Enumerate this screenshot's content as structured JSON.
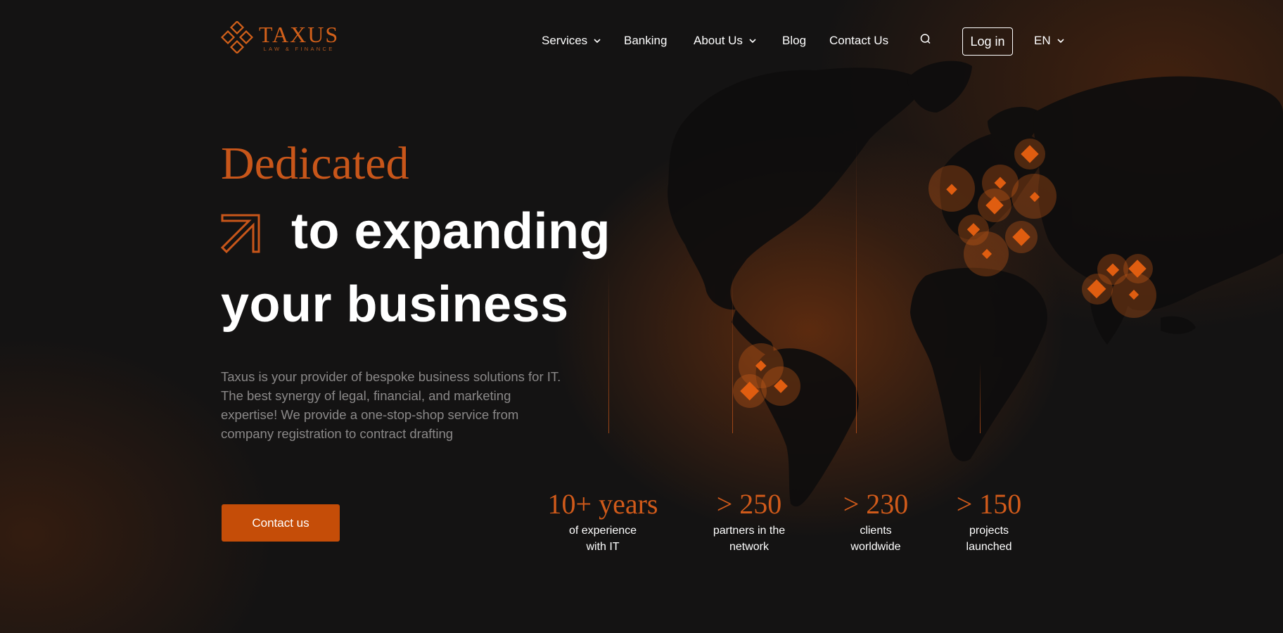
{
  "logo": {
    "name": "TAXUS",
    "tagline": "LAW & FINANCE",
    "icon": "diamond-cluster-logo",
    "brand_color": "#d2601a"
  },
  "nav": {
    "items": [
      {
        "label": "Services",
        "has_dropdown": true
      },
      {
        "label": "Banking",
        "has_dropdown": false
      },
      {
        "label": "About Us",
        "has_dropdown": true
      },
      {
        "label": "Blog",
        "has_dropdown": false
      },
      {
        "label": "Contact Us",
        "has_dropdown": false
      }
    ],
    "search_icon": "search-icon",
    "login_label": "Log in",
    "language": "EN"
  },
  "hero": {
    "line1": "Dedicated",
    "line2": "to expanding",
    "line3": "your business",
    "arrow_icon": "arrow-up-right-icon",
    "description": "Taxus is your provider of bespoke business solutions for IT. The best synergy of legal, financial, and marketing expertise! We provide a one-stop-shop service from company registration to contract drafting",
    "cta_label": "Contact us"
  },
  "stats": [
    {
      "value": "10+ years",
      "label_line1": "of experience",
      "label_line2": "with IT"
    },
    {
      "value": "> 250",
      "label_line1": "partners in the",
      "label_line2": "network"
    },
    {
      "value": "> 230",
      "label_line1": "clients",
      "label_line2": "worldwide"
    },
    {
      "value": "> 150",
      "label_line1": "projects",
      "label_line2": "launched"
    }
  ],
  "colors": {
    "accent": "#c8561a",
    "button": "#c54d08",
    "background": "#141313",
    "muted_text": "#8a8888"
  }
}
